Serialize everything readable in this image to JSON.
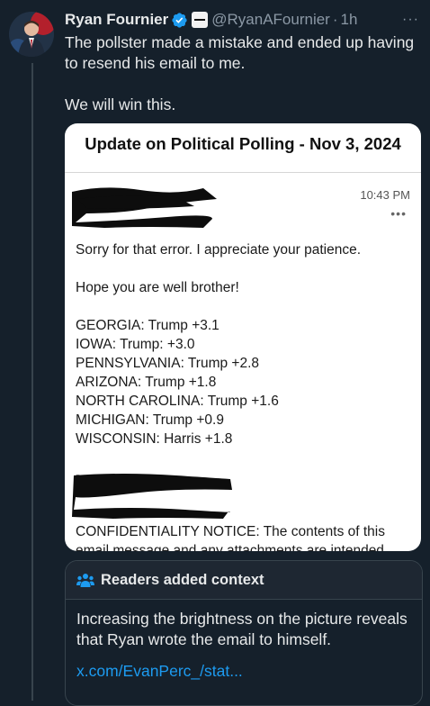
{
  "tweet": {
    "display_name": "Ryan Fournier",
    "handle": "@RyanAFournier",
    "separator": "·",
    "time": "1h",
    "more": "···",
    "text": [
      "The pollster made a mistake and ended up having to resend his email to me.",
      "We will win this."
    ]
  },
  "media": {
    "title": "Update on Political Polling - Nov 3, 2024",
    "email": {
      "time": "10:43 PM",
      "more": "•••",
      "greeting": "Sorry for that error. I appreciate your patience.",
      "wellwish": "Hope you are well brother!",
      "polls": [
        "GEORGIA: Trump +3.1",
        "IOWA: Trump: +3.0",
        "PENNSYLVANIA: Trump +2.8",
        "ARIZONA: Trump +1.8",
        "NORTH CAROLINA: Trump +1.6",
        "MICHIGAN: Trump +0.9",
        "WISCONSIN: Harris +1.8"
      ],
      "signature_dash": "-",
      "confidentiality": "CONFIDENTIALITY NOTICE: The contents of this email message and any attachments are intended"
    }
  },
  "context": {
    "title": "Readers added context",
    "body": "Increasing the brightness on the picture reveals that Ryan wrote the email to himself.",
    "link": "x.com/EvanPerc_/stat..."
  },
  "colors": {
    "background": "#15202b",
    "text": "#e7e9ea",
    "muted": "#8b98a5",
    "link": "#1d9bf0",
    "verified": "#1d9bf0"
  }
}
